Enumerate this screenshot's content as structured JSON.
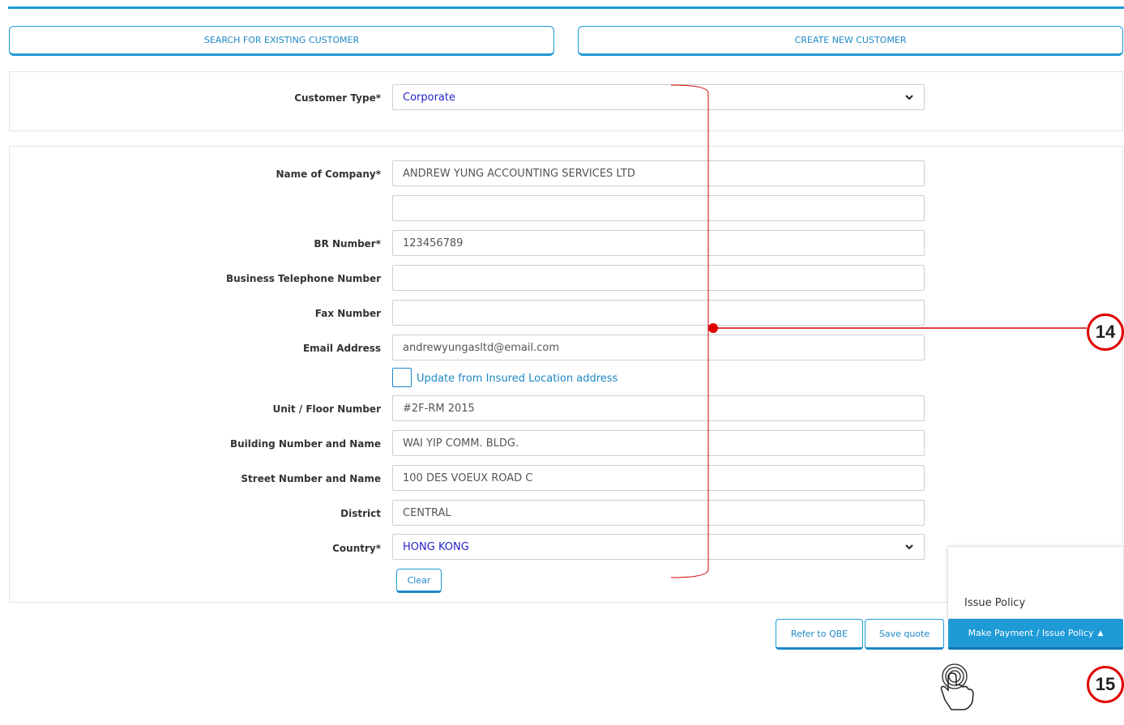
{
  "tabs": {
    "search_label": "SEARCH FOR EXISTING CUSTOMER",
    "create_label": "CREATE NEW CUSTOMER"
  },
  "customer_type": {
    "label": "Customer Type*",
    "value": "Corporate"
  },
  "form": {
    "company_name": {
      "label": "Name of Company*",
      "value": "ANDREW YUNG ACCOUNTING SERVICES LTD"
    },
    "company_name_2": {
      "value": ""
    },
    "br_number": {
      "label": "BR Number*",
      "value": "123456789"
    },
    "business_phone": {
      "label": "Business Telephone Number",
      "value": ""
    },
    "fax": {
      "label": "Fax Number",
      "value": ""
    },
    "email": {
      "label": "Email Address",
      "value": "andrewyungasltd@email.com"
    },
    "update_checkbox_label": "Update from Insured Location address",
    "unit_floor": {
      "label": "Unit / Floor Number",
      "value": "#2F-RM 2015"
    },
    "building": {
      "label": "Building Number and Name",
      "value": "WAI YIP COMM. BLDG."
    },
    "street": {
      "label": "Street Number and Name",
      "value": "100 DES VOEUX ROAD C"
    },
    "district": {
      "label": "District",
      "value": "CENTRAL"
    },
    "country": {
      "label": "Country*",
      "value": "HONG KONG"
    },
    "clear_label": "Clear"
  },
  "actions": {
    "refer_label": "Refer to QBE",
    "save_label": "Save quote",
    "pay_label": "Make Payment / Issue Policy",
    "pay_caret": "▲",
    "menu_item": "Issue Policy"
  },
  "callouts": {
    "first": "14",
    "second": "15"
  },
  "colors": {
    "accent": "#1e9bd7",
    "select_text": "#2424c8",
    "callout_red": "#e00000"
  }
}
